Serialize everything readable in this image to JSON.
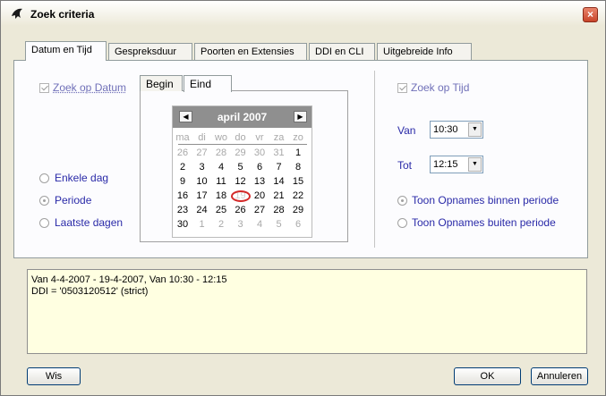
{
  "window": {
    "title": "Zoek criteria",
    "close_label": "×"
  },
  "tabs": [
    {
      "label": "Datum en Tijd",
      "active": true
    },
    {
      "label": "Gespreksduur"
    },
    {
      "label": "Poorten en Extensies"
    },
    {
      "label": "DDI en CLI"
    },
    {
      "label": "Uitgebreide Info"
    }
  ],
  "date_section": {
    "search_by_date_label": "Zoek op Datum",
    "search_by_date_checked": true,
    "subtabs": [
      {
        "label": "Begin"
      },
      {
        "label": "Eind",
        "active": true
      }
    ],
    "calendar": {
      "month_label": "april 2007",
      "prev_label": "◀",
      "next_label": "▶",
      "weekdays": [
        "ma",
        "di",
        "wo",
        "do",
        "vr",
        "za",
        "zo"
      ],
      "weeks": [
        [
          {
            "d": "26",
            "o": true
          },
          {
            "d": "27",
            "o": true
          },
          {
            "d": "28",
            "o": true
          },
          {
            "d": "29",
            "o": true
          },
          {
            "d": "30",
            "o": true
          },
          {
            "d": "31",
            "o": true
          },
          {
            "d": "1"
          }
        ],
        [
          {
            "d": "2"
          },
          {
            "d": "3"
          },
          {
            "d": "4"
          },
          {
            "d": "5"
          },
          {
            "d": "6"
          },
          {
            "d": "7"
          },
          {
            "d": "8"
          }
        ],
        [
          {
            "d": "9"
          },
          {
            "d": "10"
          },
          {
            "d": "11"
          },
          {
            "d": "12"
          },
          {
            "d": "13"
          },
          {
            "d": "14"
          },
          {
            "d": "15"
          }
        ],
        [
          {
            "d": "16"
          },
          {
            "d": "17"
          },
          {
            "d": "18"
          },
          {
            "d": "19",
            "sel": true
          },
          {
            "d": "20"
          },
          {
            "d": "21"
          },
          {
            "d": "22"
          }
        ],
        [
          {
            "d": "23"
          },
          {
            "d": "24"
          },
          {
            "d": "25"
          },
          {
            "d": "26"
          },
          {
            "d": "27"
          },
          {
            "d": "28"
          },
          {
            "d": "29"
          }
        ],
        [
          {
            "d": "30"
          },
          {
            "d": "1",
            "o": true
          },
          {
            "d": "2",
            "o": true
          },
          {
            "d": "3",
            "o": true
          },
          {
            "d": "4",
            "o": true
          },
          {
            "d": "5",
            "o": true
          },
          {
            "d": "6",
            "o": true
          }
        ]
      ]
    },
    "mode_options": [
      {
        "label": "Enkele dag",
        "selected": false
      },
      {
        "label": "Periode",
        "selected": true
      },
      {
        "label": "Laatste dagen",
        "selected": false
      }
    ]
  },
  "time_section": {
    "search_by_time_label": "Zoek op Tijd",
    "search_by_time_checked": true,
    "from_label": "Van",
    "from_value": "10:30",
    "to_label": "Tot",
    "to_value": "12:15",
    "dropdown_glyph": "▼",
    "period_options": [
      {
        "label": "Toon Opnames binnen periode",
        "selected": true
      },
      {
        "label": "Toon Opnames buiten periode",
        "selected": false
      }
    ]
  },
  "summary": {
    "lines": [
      "Van 4-4-2007 - 19-4-2007, Van 10:30 - 12:15",
      "DDI = '0503120512' (strict)"
    ]
  },
  "buttons": {
    "clear_label": "Wis",
    "ok_label": "OK",
    "cancel_label": "Annuleren"
  }
}
